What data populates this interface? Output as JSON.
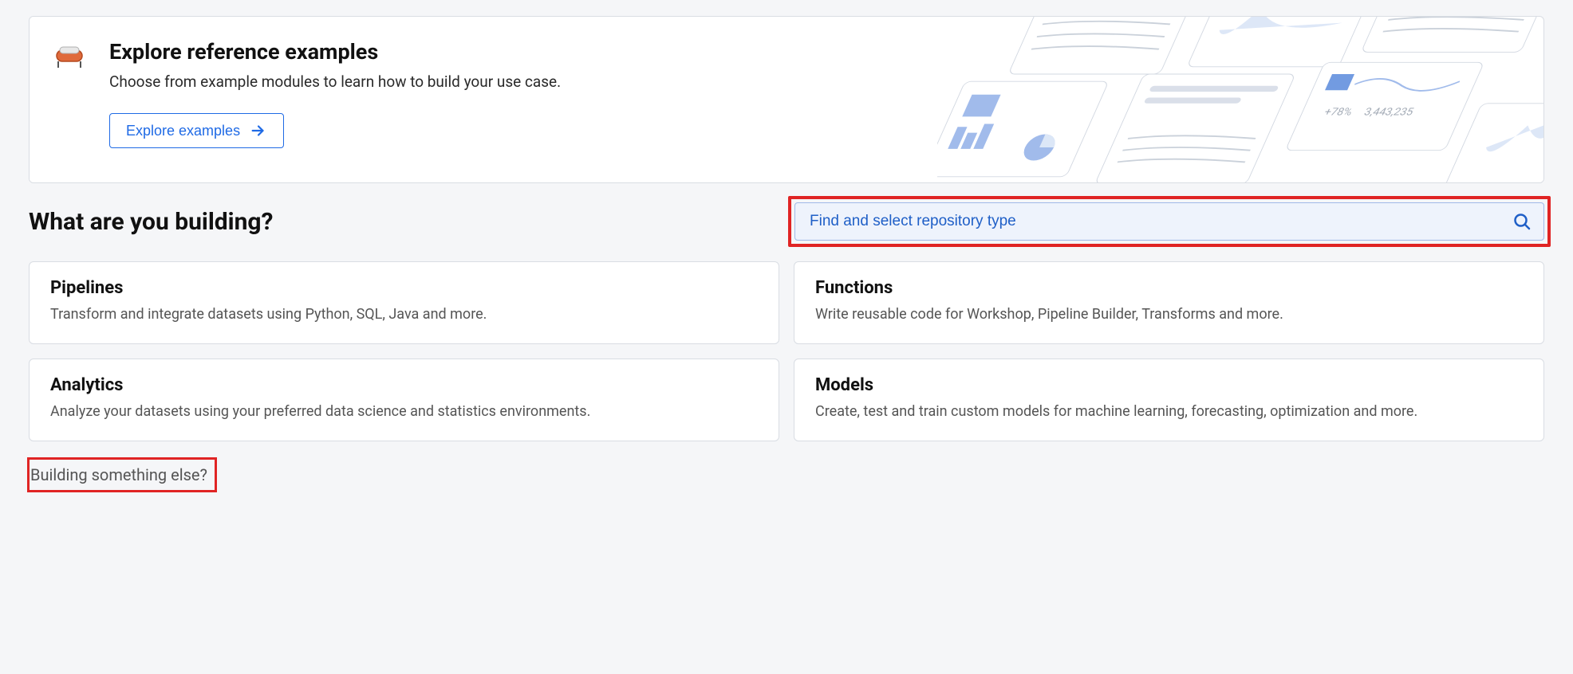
{
  "banner": {
    "title": "Explore reference examples",
    "subtitle": "Choose from example modules to learn how to build your use case.",
    "button_label": "Explore examples"
  },
  "heading": "What are you building?",
  "search": {
    "placeholder": "Find and select repository type"
  },
  "cards": [
    {
      "title": "Pipelines",
      "desc": "Transform and integrate datasets using Python, SQL, Java and more."
    },
    {
      "title": "Functions",
      "desc": "Write reusable code for Workshop, Pipeline Builder, Transforms and more."
    },
    {
      "title": "Analytics",
      "desc": "Analyze your datasets using your preferred data science and statistics environments."
    },
    {
      "title": "Models",
      "desc": "Create, test and train custom models for machine learning, forecasting, optimization and more."
    }
  ],
  "footer_link": "Building something else?"
}
